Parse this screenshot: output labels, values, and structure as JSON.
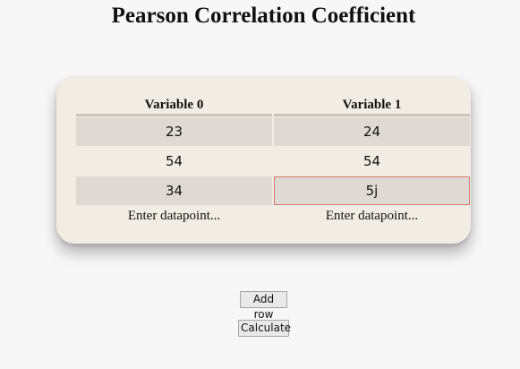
{
  "page": {
    "title": "Pearson Correlation Coefficient"
  },
  "table": {
    "columns": [
      {
        "header": "Variable 0",
        "cells": [
          "23",
          "54",
          "34"
        ],
        "entry_placeholder": "Enter datapoint..."
      },
      {
        "header": "Variable 1",
        "cells": [
          "24",
          "54",
          "5j"
        ],
        "entry_placeholder": "Enter datapoint..."
      }
    ]
  },
  "buttons": {
    "add_row": "Add row",
    "calculate": "Calculate"
  },
  "colors": {
    "page_background": "#f7f7f7",
    "card_background": "#f1ede4",
    "shaded_row": "#dedad3",
    "invalid_border": "#d4776a"
  }
}
